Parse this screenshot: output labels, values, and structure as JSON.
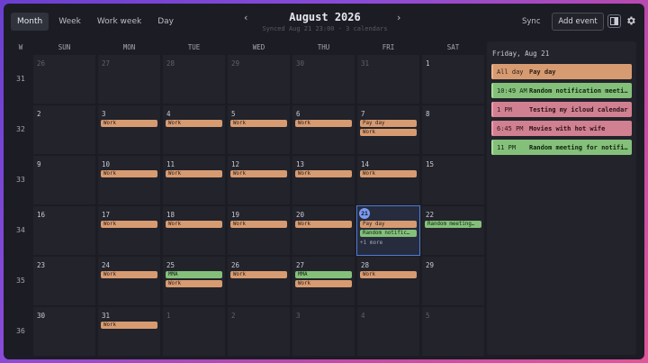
{
  "header": {
    "view_tabs": [
      "Month",
      "Week",
      "Work week",
      "Day"
    ],
    "active_view": "Month",
    "month_title": "August 2026",
    "sync_status": "Synced Aug 21 23:00 · 3 calendars",
    "sync_label": "Sync",
    "add_event_label": "Add event",
    "prev_icon": "‹",
    "next_icon": "›"
  },
  "grid": {
    "week_col_label": "W",
    "weekdays": [
      "SUN",
      "MON",
      "TUE",
      "WED",
      "THU",
      "FRI",
      "SAT"
    ],
    "weeks": [
      {
        "num": "31",
        "days": [
          {
            "d": "26",
            "other": true,
            "events": []
          },
          {
            "d": "27",
            "other": true,
            "events": []
          },
          {
            "d": "28",
            "other": true,
            "events": []
          },
          {
            "d": "29",
            "other": true,
            "events": []
          },
          {
            "d": "30",
            "other": true,
            "events": []
          },
          {
            "d": "31",
            "other": true,
            "events": []
          },
          {
            "d": "1",
            "events": []
          }
        ]
      },
      {
        "num": "32",
        "days": [
          {
            "d": "2",
            "events": []
          },
          {
            "d": "3",
            "events": [
              {
                "t": "Work",
                "c": "orange"
              }
            ]
          },
          {
            "d": "4",
            "events": [
              {
                "t": "Work",
                "c": "orange"
              }
            ]
          },
          {
            "d": "5",
            "events": [
              {
                "t": "Work",
                "c": "orange"
              }
            ]
          },
          {
            "d": "6",
            "events": [
              {
                "t": "Work",
                "c": "orange"
              }
            ]
          },
          {
            "d": "7",
            "events": [
              {
                "t": "Pay day",
                "c": "orange"
              },
              {
                "t": "Work",
                "c": "orange"
              }
            ]
          },
          {
            "d": "8",
            "events": []
          }
        ]
      },
      {
        "num": "33",
        "days": [
          {
            "d": "9",
            "events": []
          },
          {
            "d": "10",
            "events": [
              {
                "t": "Work",
                "c": "orange"
              }
            ]
          },
          {
            "d": "11",
            "events": [
              {
                "t": "Work",
                "c": "orange"
              }
            ]
          },
          {
            "d": "12",
            "events": [
              {
                "t": "Work",
                "c": "orange"
              }
            ]
          },
          {
            "d": "13",
            "events": [
              {
                "t": "Work",
                "c": "orange"
              }
            ]
          },
          {
            "d": "14",
            "events": [
              {
                "t": "Work",
                "c": "orange"
              }
            ]
          },
          {
            "d": "15",
            "events": []
          }
        ]
      },
      {
        "num": "34",
        "days": [
          {
            "d": "16",
            "events": []
          },
          {
            "d": "17",
            "events": [
              {
                "t": "Work",
                "c": "orange"
              }
            ]
          },
          {
            "d": "18",
            "events": [
              {
                "t": "Work",
                "c": "orange"
              }
            ]
          },
          {
            "d": "19",
            "events": [
              {
                "t": "Work",
                "c": "orange"
              }
            ]
          },
          {
            "d": "20",
            "events": [
              {
                "t": "Work",
                "c": "orange"
              }
            ]
          },
          {
            "d": "21",
            "today": true,
            "events": [
              {
                "t": "Pay day",
                "c": "orange"
              },
              {
                "t": "Random notific…",
                "c": "green"
              }
            ],
            "more": "+1 more"
          },
          {
            "d": "22",
            "events": [
              {
                "t": "Random meeting…",
                "c": "green"
              }
            ]
          }
        ]
      },
      {
        "num": "35",
        "days": [
          {
            "d": "23",
            "events": []
          },
          {
            "d": "24",
            "events": [
              {
                "t": "Work",
                "c": "orange"
              }
            ]
          },
          {
            "d": "25",
            "events": [
              {
                "t": "MMA",
                "c": "green"
              },
              {
                "t": "Work",
                "c": "orange"
              }
            ]
          },
          {
            "d": "26",
            "events": [
              {
                "t": "Work",
                "c": "orange"
              }
            ]
          },
          {
            "d": "27",
            "events": [
              {
                "t": "MMA",
                "c": "green"
              },
              {
                "t": "Work",
                "c": "orange"
              }
            ]
          },
          {
            "d": "28",
            "events": [
              {
                "t": "Work",
                "c": "orange"
              }
            ]
          },
          {
            "d": "29",
            "events": []
          }
        ]
      },
      {
        "num": "36",
        "days": [
          {
            "d": "30",
            "events": []
          },
          {
            "d": "31",
            "events": [
              {
                "t": "Work",
                "c": "orange"
              }
            ]
          },
          {
            "d": "1",
            "other": true,
            "events": []
          },
          {
            "d": "2",
            "other": true,
            "events": []
          },
          {
            "d": "3",
            "other": true,
            "events": []
          },
          {
            "d": "4",
            "other": true,
            "events": []
          },
          {
            "d": "5",
            "other": true,
            "events": []
          }
        ]
      }
    ]
  },
  "side_panel": {
    "date_label": "Friday, Aug 21",
    "events": [
      {
        "time": "All day",
        "name": "Pay day",
        "color": "orange"
      },
      {
        "time": "10:49 AM",
        "name": "Random notification meeting",
        "color": "green"
      },
      {
        "time": "1 PM",
        "name": "Testing my icloud calendar",
        "color": "pink"
      },
      {
        "time": "6:45 PM",
        "name": "Movies with hot wife",
        "color": "pink"
      },
      {
        "time": "11 PM",
        "name": "Random meeting for notifications",
        "color": "green"
      }
    ]
  },
  "colors": {
    "accent": "#7a9cf0",
    "orange_event": "#d79b72",
    "green_event": "#84c07a",
    "pink_event": "#d08090"
  }
}
